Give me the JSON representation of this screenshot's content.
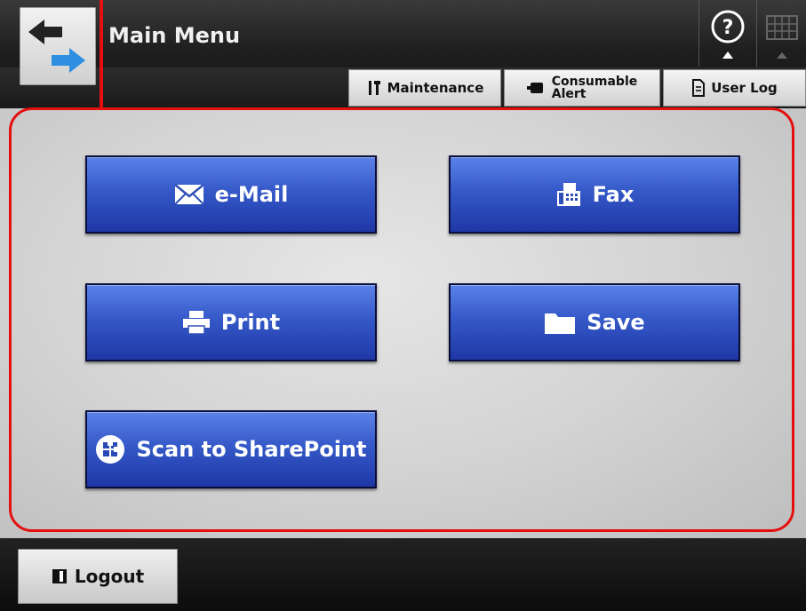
{
  "header": {
    "title": "Main Menu",
    "icons": {
      "back": "back-arrow-icon",
      "help": "help-icon",
      "keyboard": "keyboard-icon"
    },
    "tabs": [
      {
        "id": "maintenance",
        "label": "Maintenance",
        "icon": "wrench-screwdriver-icon"
      },
      {
        "id": "consumable",
        "label_line1": "Consumable",
        "label_line2": "Alert",
        "icon": "toner-cartridge-icon"
      },
      {
        "id": "userlog",
        "label": "User Log",
        "icon": "document-icon"
      }
    ]
  },
  "menu": {
    "email": {
      "label": "e-Mail",
      "icon": "envelope-icon"
    },
    "fax": {
      "label": "Fax",
      "icon": "fax-machine-icon"
    },
    "print": {
      "label": "Print",
      "icon": "printer-icon"
    },
    "save": {
      "label": "Save",
      "icon": "folder-icon"
    },
    "sharepoint": {
      "label": "Scan to SharePoint",
      "icon": "sharepoint-icon"
    }
  },
  "footer": {
    "logout_label": "Logout",
    "logout_icon": "door-icon"
  },
  "colors": {
    "highlight": "#e41010",
    "button_blue": "#3559c8",
    "header_dark": "#1e1e1e"
  }
}
